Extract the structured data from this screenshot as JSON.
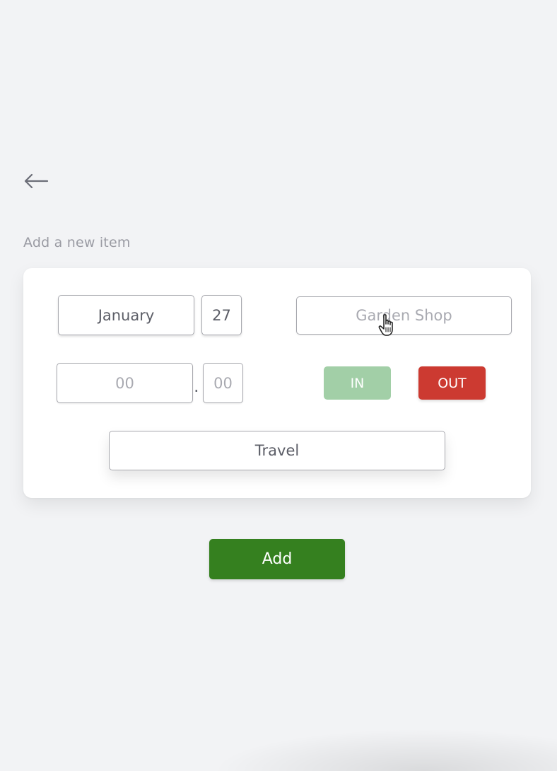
{
  "header": {
    "back_icon": "arrow-left-icon"
  },
  "section": {
    "label": "Add a new item"
  },
  "form": {
    "month": "January",
    "day": "27",
    "shop_placeholder": "Garden Shop",
    "amount_major_placeholder": "00",
    "decimal_separator": ".",
    "amount_minor_placeholder": "00",
    "in_label": "IN",
    "out_label": "OUT",
    "category": "Travel"
  },
  "actions": {
    "add_label": "Add"
  },
  "colors": {
    "in_toggle": "#a2cfa7",
    "out_toggle": "#cc3a31",
    "add_button": "#35801f"
  },
  "cursor": {
    "icon": "hand-pointer-icon"
  }
}
